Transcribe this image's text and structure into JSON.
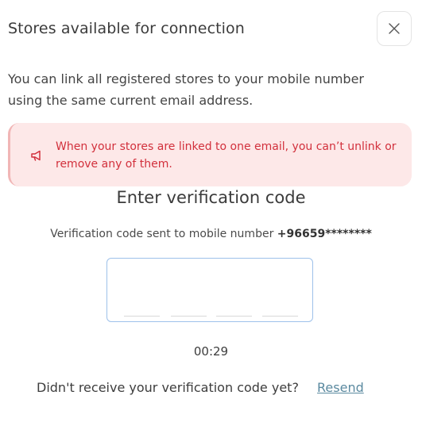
{
  "header": {
    "title": "Stores available for connection",
    "close_icon": "close-icon"
  },
  "description": "You can link all registered stores to your mobile number using the same current email address.",
  "alert": {
    "icon": "megaphone-icon",
    "text": "When your stores are linked to one email, you can’t unlink or remove any of them.",
    "bg_color": "#fde8e8",
    "text_color": "#d2303c"
  },
  "verification": {
    "title": "Enter verification code",
    "sent_prefix": "Verification code sent to mobile number",
    "phone": "+96659********",
    "code_value": "",
    "timer": "00:29",
    "resend_prompt": "Didn't receive your verification code yet?",
    "resend_label": "Resend"
  }
}
